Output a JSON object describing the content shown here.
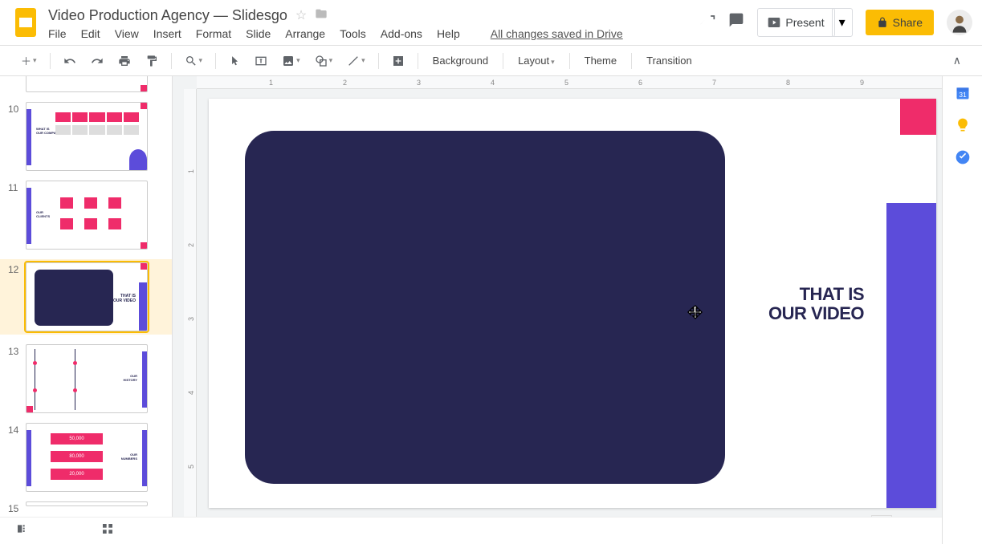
{
  "doc": {
    "title": "Video Production Agency — Slidesgo",
    "saved": "All changes saved in Drive"
  },
  "menus": {
    "file": "File",
    "edit": "Edit",
    "view": "View",
    "insert": "Insert",
    "format": "Format",
    "slide": "Slide",
    "arrange": "Arrange",
    "tools": "Tools",
    "addons": "Add-ons",
    "help": "Help"
  },
  "header": {
    "present": "Present",
    "share": "Share"
  },
  "toolbar": {
    "background": "Background",
    "layout": "Layout",
    "theme": "Theme",
    "transition": "Transition"
  },
  "ruler": {
    "h": [
      "1",
      "2",
      "3",
      "4",
      "5",
      "6",
      "7",
      "8",
      "9"
    ],
    "v": [
      "1",
      "2",
      "3",
      "4",
      "5"
    ]
  },
  "slide": {
    "line1": "THAT IS",
    "line2": "OUR VIDEO"
  },
  "thumbs": {
    "n9": "",
    "n10": "10",
    "n11": "11",
    "n12": "12",
    "n13": "13",
    "n14": "14",
    "n15": "15",
    "t10a": "WHAT IS",
    "t10b": "OUR COMPANY",
    "t11a": "OUR",
    "t11b": "CLIENTS",
    "t12a": "THAT IS",
    "t12b": "OUR VIDEO",
    "t13a": "OUR",
    "t13b": "HISTORY",
    "t14a": "50,000",
    "t14b": "80,000",
    "t14c": "20,000",
    "t14d": "OUR",
    "t14e": "NUMBERS"
  }
}
